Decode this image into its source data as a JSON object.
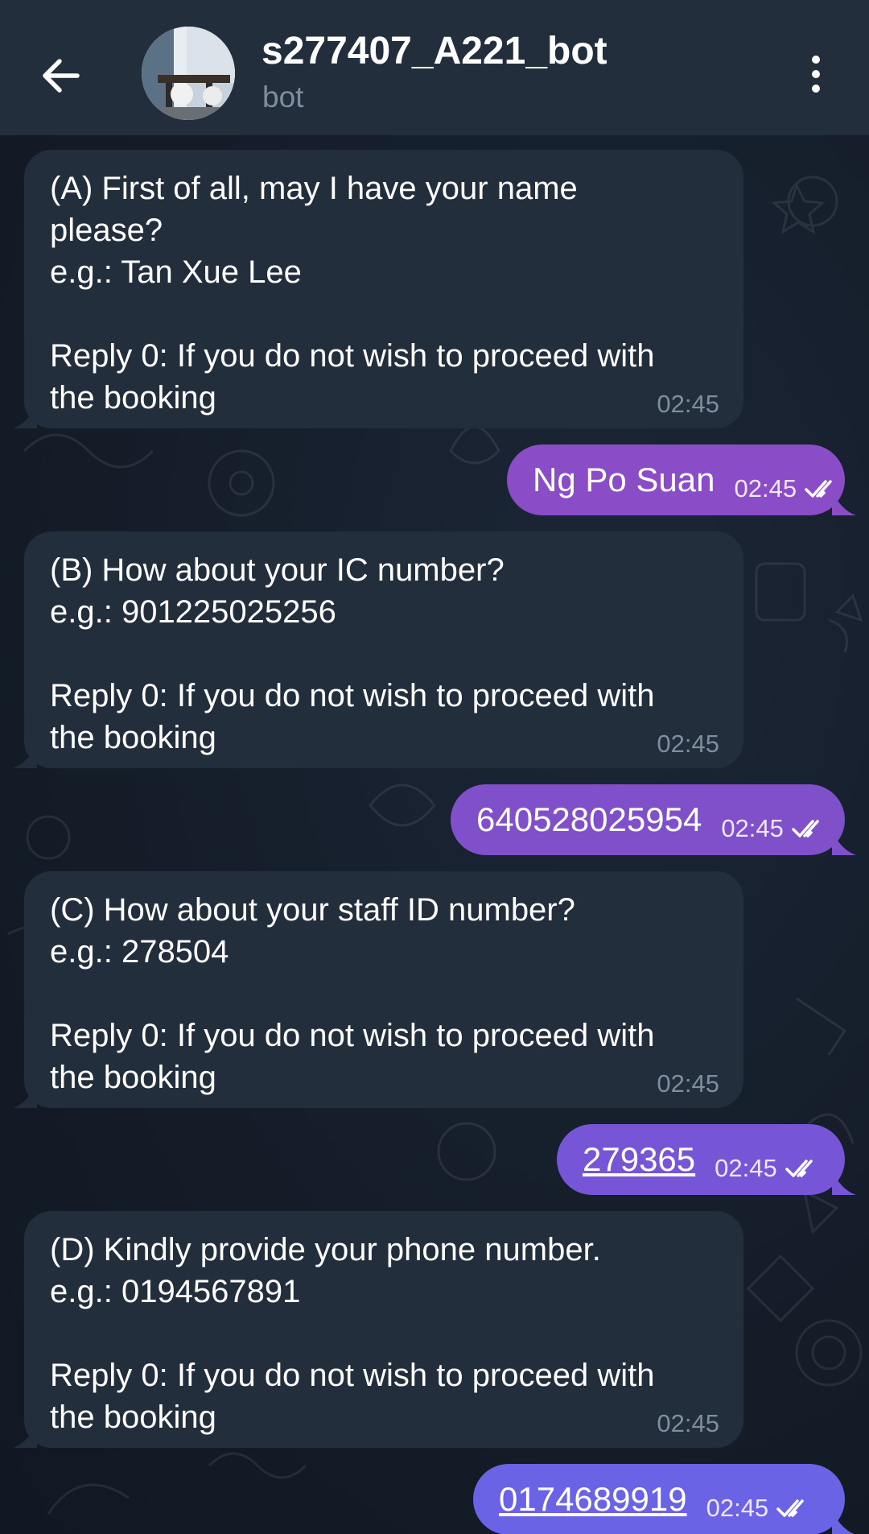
{
  "header": {
    "title": "s277407_A221_bot",
    "subtitle": "bot"
  },
  "colors": {
    "header_bg": "#232e3c",
    "incoming_bubble": "#232e3c",
    "outgoing_bubble_top": "#8a4cc7",
    "outgoing_bubble_bottom": "#6b63e6",
    "background": "#172030"
  },
  "icons": {
    "back": "arrow-left-icon",
    "menu": "more-vertical-icon",
    "read": "double-check-icon"
  },
  "messages": [
    {
      "direction": "incoming",
      "text": "(A) First of all, may I have your name\nplease?\ne.g.: Tan Xue Lee\n\nReply 0: If you do not wish to proceed with\nthe booking",
      "time": "02:45"
    },
    {
      "direction": "outgoing",
      "text": "Ng Po Suan",
      "time": "02:45",
      "status": "read"
    },
    {
      "direction": "incoming",
      "text": "(B) How about your IC number?\ne.g.: 901225025256\n\nReply 0: If you do not wish to proceed with\nthe booking",
      "time": "02:45"
    },
    {
      "direction": "outgoing",
      "text": "640528025954",
      "time": "02:45",
      "status": "read"
    },
    {
      "direction": "incoming",
      "text": "(C) How about your staff ID number?\ne.g.: 278504\n\nReply 0: If you do not wish to proceed with\nthe booking",
      "time": "02:45"
    },
    {
      "direction": "outgoing",
      "text": "279365",
      "time": "02:45",
      "status": "read",
      "link": true
    },
    {
      "direction": "incoming",
      "text": "(D) Kindly provide your phone number.\ne.g.: 0194567891\n\nReply 0: If you do not wish to proceed with\nthe booking",
      "time": "02:45"
    },
    {
      "direction": "outgoing",
      "text": "0174689919",
      "time": "02:45",
      "status": "read",
      "link": true
    }
  ]
}
